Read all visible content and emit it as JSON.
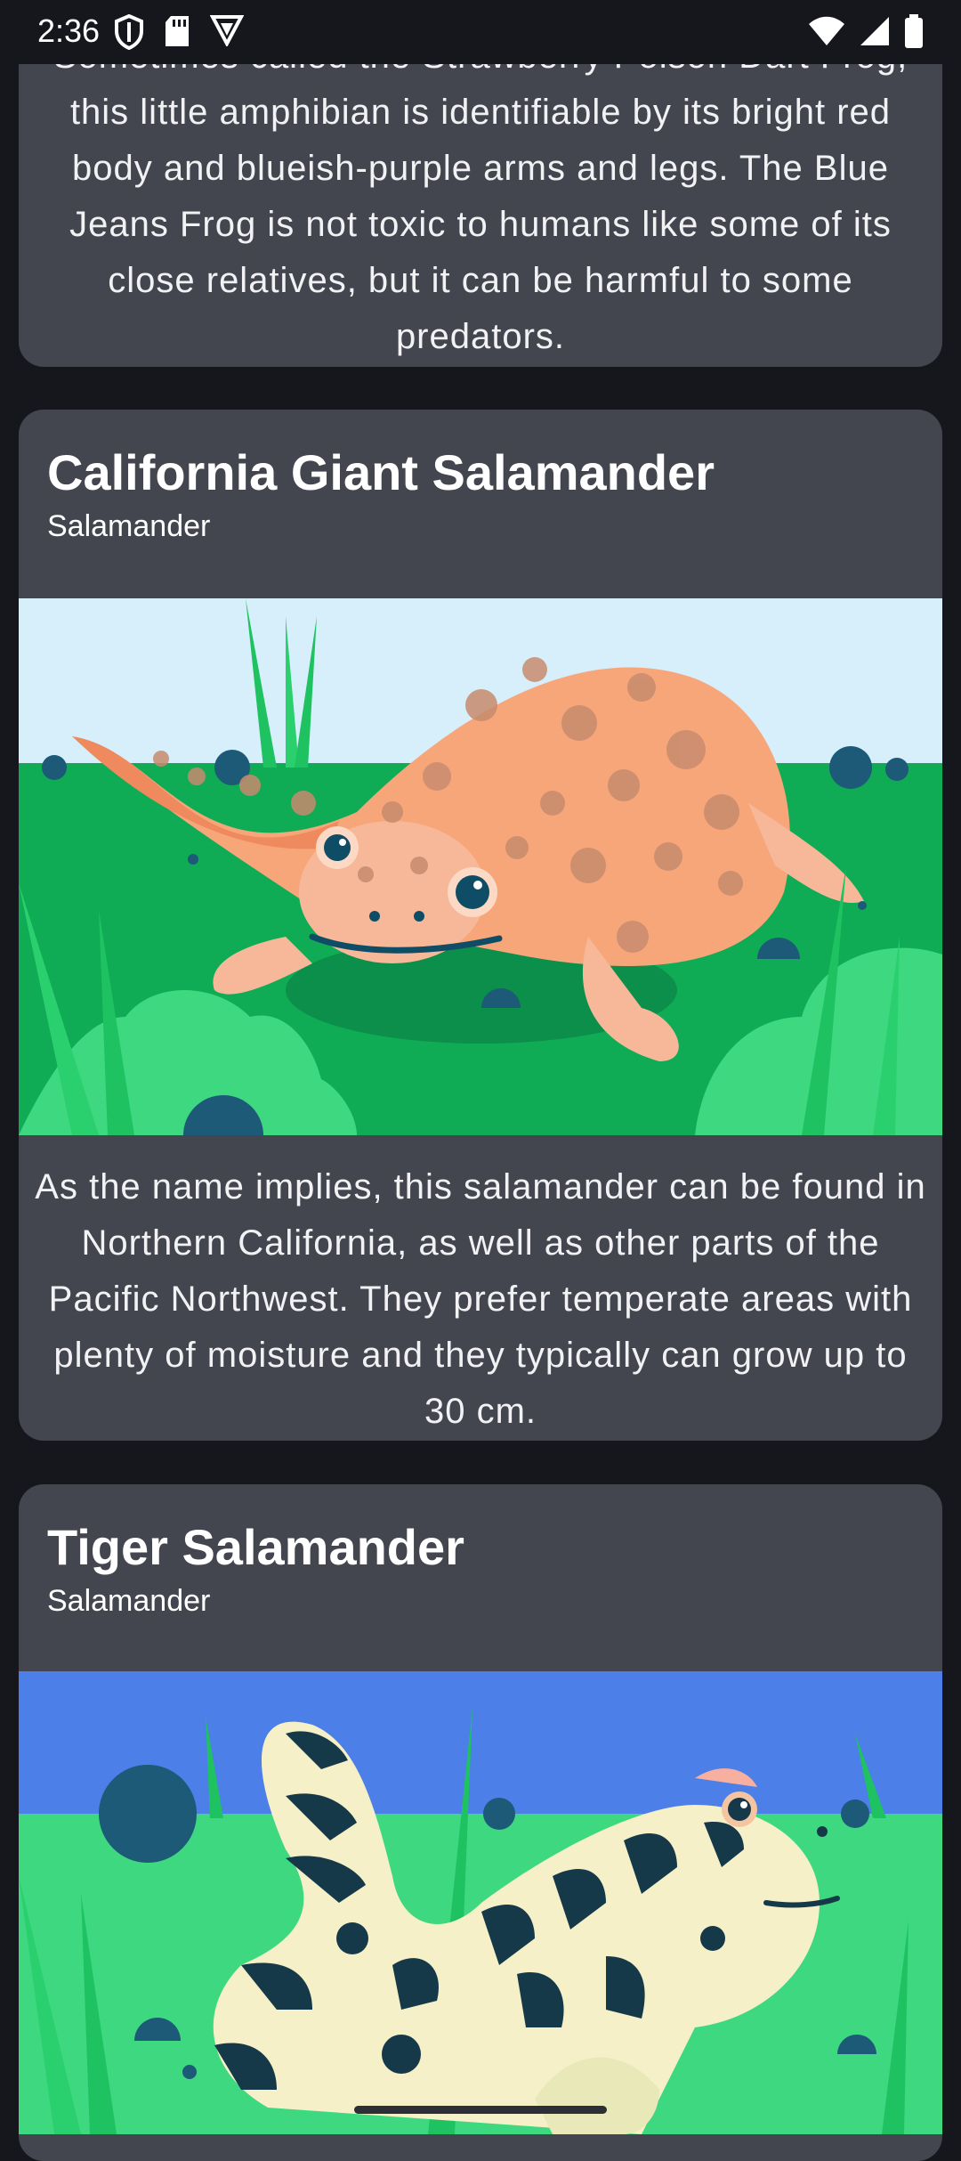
{
  "status_bar": {
    "time": "2:36",
    "left_icons": [
      "shield-icon",
      "sd-card-icon",
      "vpn-icon"
    ],
    "right_icons": [
      "wifi-icon",
      "signal-icon",
      "battery-icon"
    ]
  },
  "cards": [
    {
      "description": "Sometimes called the Strawberry Poison Dart Frog, this little amphibian is identifiable by its bright red body and blueish-purple arms and legs. The Blue Jeans Frog is not toxic to humans like some of its close relatives, but it can be harmful to some predators."
    },
    {
      "title": "California Giant Salamander",
      "type": "Salamander",
      "image": "california-giant-salamander-illustration",
      "description": "As the name implies, this salamander can be found in Northern California, as well as other parts of the Pacific Northwest. They prefer temperate areas with plenty of moisture and they typically can grow up to 30 cm."
    },
    {
      "title": "Tiger Salamander",
      "type": "Salamander",
      "image": "tiger-salamander-illustration"
    }
  ],
  "colors": {
    "background": "#15171d",
    "card": "#44464f",
    "grass": "#0fac55",
    "sky_light": "#d6effb",
    "sky_blue": "#4c7fe7"
  }
}
